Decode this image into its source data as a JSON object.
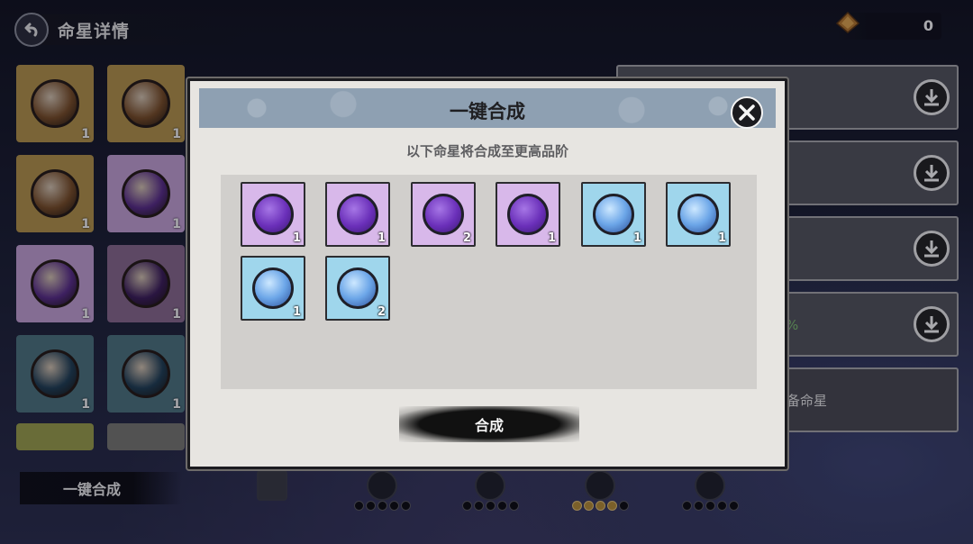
{
  "header": {
    "title": "命星详情",
    "currency_value": "0"
  },
  "left_grid": {
    "cells": [
      {
        "color": "#b7964a",
        "orb": "#7a4e26",
        "count": "1"
      },
      {
        "color": "#b7964a",
        "orb": "#7a4e26",
        "count": "1"
      },
      {
        "color": "#b7964a",
        "orb": "#7a4e26",
        "count": "1"
      },
      {
        "color": "#c7a3d8",
        "orb": "#5a2d8a",
        "count": "1"
      },
      {
        "color": "#c7a3d8",
        "orb": "#5a2d8a",
        "count": "1"
      },
      {
        "color": "#8a6a8f",
        "orb": "#3c1d5a",
        "count": "1"
      },
      {
        "color": "#4d7580",
        "orb": "#1f3f55",
        "count": "1"
      },
      {
        "color": "#4d7580",
        "orb": "#1f3f55",
        "count": "1"
      }
    ]
  },
  "right_panels": {
    "percent_text": "%",
    "equip_text": "装备命星"
  },
  "bottom": {
    "one_click_label": "一键合成"
  },
  "tabs": [
    {
      "icon": "grid-icon",
      "dots": []
    },
    {
      "icon": "antler-icon",
      "dots": [
        0,
        0,
        0,
        0,
        0
      ]
    },
    {
      "icon": "moon-icon",
      "dots": [
        0,
        0,
        0,
        0,
        0
      ]
    },
    {
      "icon": "claw-icon",
      "dots": [
        1,
        1,
        1,
        1,
        0
      ]
    },
    {
      "icon": "shell-icon",
      "dots": [
        0,
        0,
        0,
        0,
        0
      ]
    }
  ],
  "modal": {
    "title": "一键合成",
    "subtitle": "以下命星将合成至更高品阶",
    "confirm_label": "合成",
    "items": [
      {
        "tier": "purple",
        "icon": "antler-icon",
        "count": "1"
      },
      {
        "tier": "purple",
        "icon": "antler-icon",
        "count": "1"
      },
      {
        "tier": "purple",
        "icon": "antler-icon",
        "count": "2"
      },
      {
        "tier": "purple",
        "icon": "antler-icon",
        "count": "1"
      },
      {
        "tier": "blue",
        "icon": "shell-icon",
        "count": "1"
      },
      {
        "tier": "blue",
        "icon": "shell-icon",
        "count": "1"
      },
      {
        "tier": "blue",
        "icon": "shell-icon",
        "count": "1"
      },
      {
        "tier": "blue",
        "icon": "shell-icon",
        "count": "2"
      }
    ]
  },
  "colors": {
    "active_dot": "#b98f37",
    "header_band": "#8ea0b2",
    "purple_tile": "#d8b8ea",
    "blue_tile": "#9fd6ec"
  }
}
